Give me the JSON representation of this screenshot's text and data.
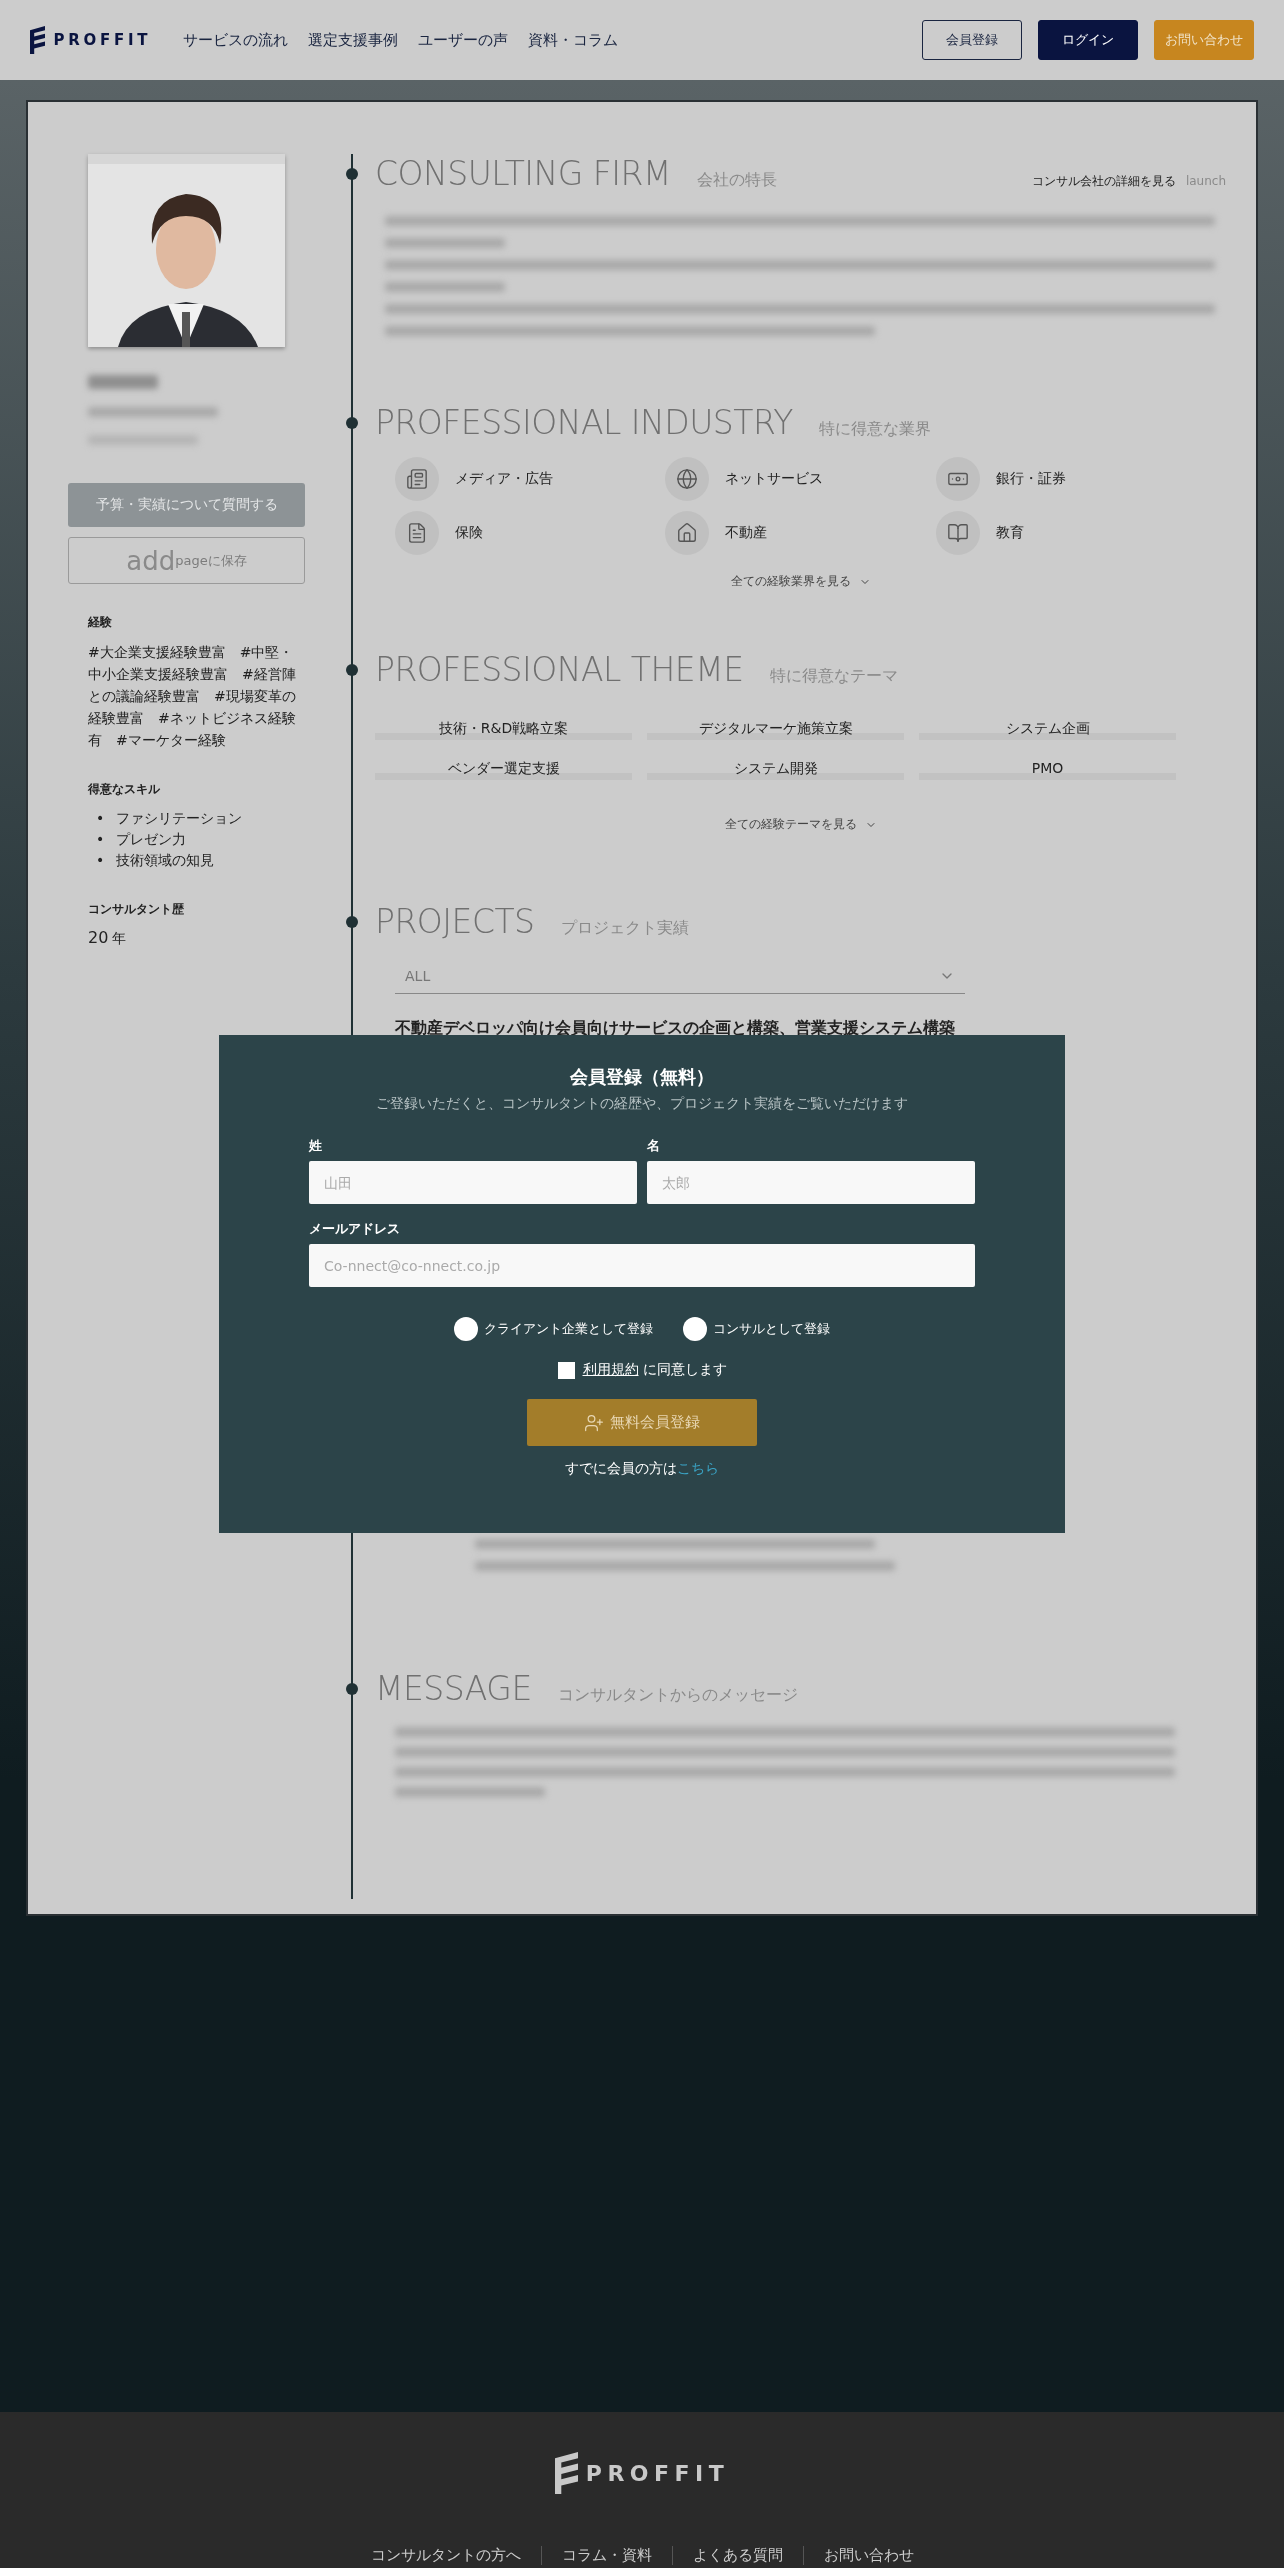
{
  "header": {
    "logo": "PROFFIT",
    "nav": [
      "サービスの流れ",
      "選定支援事例",
      "ユーザーの声",
      "資料・コラム"
    ],
    "buttons": [
      {
        "label": "会員登録",
        "kind": "outline"
      },
      {
        "label": "ログイン",
        "kind": "primary"
      },
      {
        "label": "お問い合わせ",
        "kind": "accent"
      }
    ]
  },
  "profile": {
    "ask_button": "予算・実績について質問する",
    "save_button": {
      "icon_text": "add",
      "label": "pageに保存"
    },
    "experience": {
      "title": "経験",
      "tags": "#大企業支援経験豊富　#中堅・中小企業支援経験豊富　#経営陣との議論経験豊富　#現場変革の経験豊富　#ネットビジネス経験有　#マーケター経験"
    },
    "skills": {
      "title": "得意なスキル",
      "marker": "•",
      "items": [
        "ファシリテーション",
        "プレゼン力",
        "技術領域の知見"
      ]
    },
    "career": {
      "title": "コンサルタント歴",
      "value": "20",
      "unit": "年"
    }
  },
  "consulting_firm": {
    "title": "CONSULTING FIRM",
    "subtitle": "会社の特長",
    "link": "コンサル会社の詳細を見る",
    "link_icon_text": "launch"
  },
  "industry": {
    "title": "PROFESSIONAL INDUSTRY",
    "subtitle": "特に得意な業界",
    "items": [
      "メディア・広告",
      "ネットサービス",
      "銀行・証券",
      "保険",
      "不動産",
      "教育"
    ],
    "more": "全ての経験業界を見る"
  },
  "theme": {
    "title": "PROFESSIONAL THEME",
    "subtitle": "特に得意なテーマ",
    "items": [
      "技術・R&D戦略立案",
      "デジタルマーケ施策立案",
      "システム企画",
      "ベンダー選定支援",
      "システム開発",
      "PMO"
    ],
    "more": "全ての経験テーマを見る"
  },
  "projects": {
    "title": "PROJECTS",
    "subtitle": "プロジェクト実績",
    "filter": "ALL",
    "project_title": "不動産デベロッパ向け会員向けサービスの企画と構築、営業支援システム構築"
  },
  "message": {
    "title": "MESSAGE",
    "subtitle": "コンサルタントからのメッセージ"
  },
  "modal": {
    "title": "会員登録（無料）",
    "subtitle": "ご登録いただくと、コンサルタントの経歴や、プロジェクト実績をご覧いただけます",
    "last_name": {
      "label": "姓",
      "placeholder": "山田"
    },
    "first_name": {
      "label": "名",
      "placeholder": "太郎"
    },
    "email": {
      "label": "メールアドレス",
      "placeholder": "Co-nnect@co-nnect.co.jp"
    },
    "roles": [
      {
        "label": "クライアント企業として登録",
        "selected": false
      },
      {
        "label": "コンサルとして登録",
        "selected": false
      }
    ],
    "terms": {
      "link": "利用規約",
      "text": "に同意します",
      "checked": false
    },
    "submit": "無料会員登録",
    "login_prompt": {
      "text": "すでに会員の方は",
      "link": "こちら"
    }
  },
  "footer": {
    "logo": "PROFFIT",
    "links": [
      "コンサルタントの方へ",
      "コラム・資料",
      "よくある質問",
      "お問い合わせ"
    ]
  }
}
